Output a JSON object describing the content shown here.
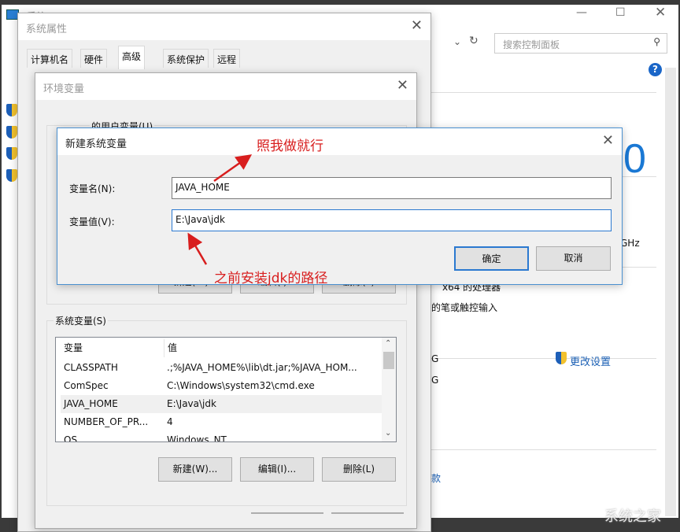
{
  "control_panel": {
    "title": "系统",
    "search_placeholder": "搜索控制面板",
    "big_text": "0",
    "ghz": "GHz",
    "processor": "x64 的处理器",
    "pen": "的笔或触控输入",
    "g1": "G",
    "g2": "G",
    "change_settings": "更改设置",
    "tail": "款",
    "watermark": "系统之家"
  },
  "sys_props": {
    "title": "系统属性",
    "tabs": [
      "计算机名",
      "硬件",
      "高级",
      "系统保护",
      "远程"
    ],
    "active_tab": "高级"
  },
  "env_vars": {
    "title": "环境变量",
    "user_group": "的用户变量(U)",
    "system_group": "系统变量(S)",
    "columns": [
      "变量",
      "值"
    ],
    "rows": [
      [
        "CLASSPATH",
        ".;%JAVA_HOME%\\lib\\dt.jar;%JAVA_HOM..."
      ],
      [
        "ComSpec",
        "C:\\Windows\\system32\\cmd.exe"
      ],
      [
        "JAVA_HOME",
        "E:\\Java\\jdk"
      ],
      [
        "NUMBER_OF_PR...",
        "4"
      ],
      [
        "OS",
        "Windows_NT"
      ]
    ],
    "selected_row": "JAVA_HOME",
    "buttons": {
      "new": "新建(W)...",
      "edit": "编辑(I)...",
      "delete": "删除(L)"
    }
  },
  "new_var": {
    "title": "新建系统变量",
    "name_label": "变量名(N):",
    "name_value": "JAVA_HOME",
    "value_label": "变量值(V):",
    "value_value": "E:\\Java\\jdk",
    "ok": "确定",
    "cancel": "取消"
  },
  "annotations": {
    "top": "照我做就行",
    "bottom": "之前安装jdk的路径",
    "color": "#d81e1e"
  }
}
